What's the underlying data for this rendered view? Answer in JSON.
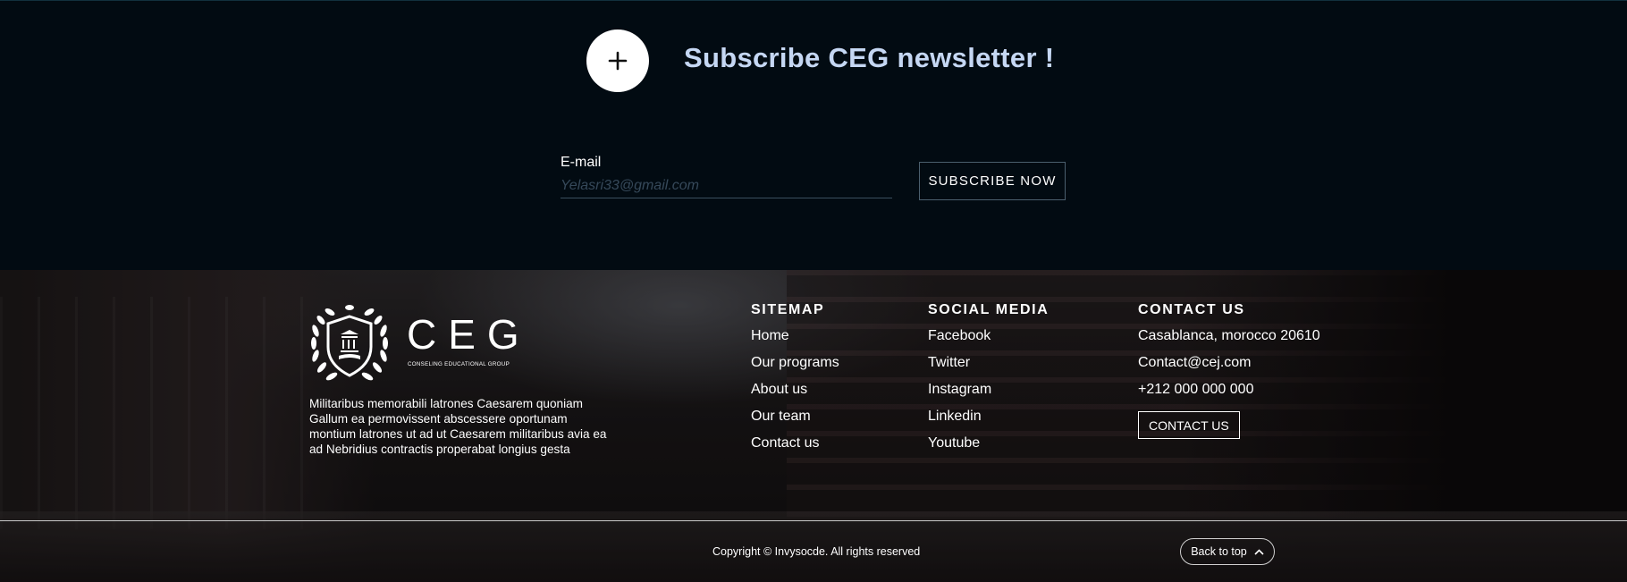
{
  "newsletter": {
    "title": "Subscribe CEG newsletter !",
    "email_label": "E-mail",
    "email_placeholder": "Yelasri33@gmail.com",
    "subscribe_label": "SUBSCRIBE NOW",
    "plus_icon": "plus-icon"
  },
  "footer": {
    "logo": {
      "text": "CEG",
      "subtitle": "CONSELING EDUCATIONAL GROUP"
    },
    "description": "Militaribus memorabili latrones Caesarem quoniam Gallum ea permovissent abscessere oportunam montium latrones ut ad ut Caesarem militaribus avia ea ad Nebridius contractis properabat longius gesta",
    "sitemap": {
      "heading": "SITEMAP",
      "items": [
        "Home",
        "Our programs",
        "About us",
        "Our team",
        "Contact us"
      ]
    },
    "social": {
      "heading": "SOCIAL MEDIA",
      "items": [
        "Facebook",
        "Twitter",
        "Instagram",
        "Linkedin",
        "Youtube"
      ]
    },
    "contact": {
      "heading": "CONTACT US",
      "address": "Casablanca, morocco 20610",
      "email": "Contact@cej.com",
      "phone": "+212 000 000 000",
      "button_label": "CONTACT US"
    },
    "copyright": "Copyright © Invysocde. All rights reserved",
    "back_to_top": "Back to top"
  },
  "colors": {
    "newsletter_bg": "#020b12",
    "title_color": "#c5d7f3"
  }
}
